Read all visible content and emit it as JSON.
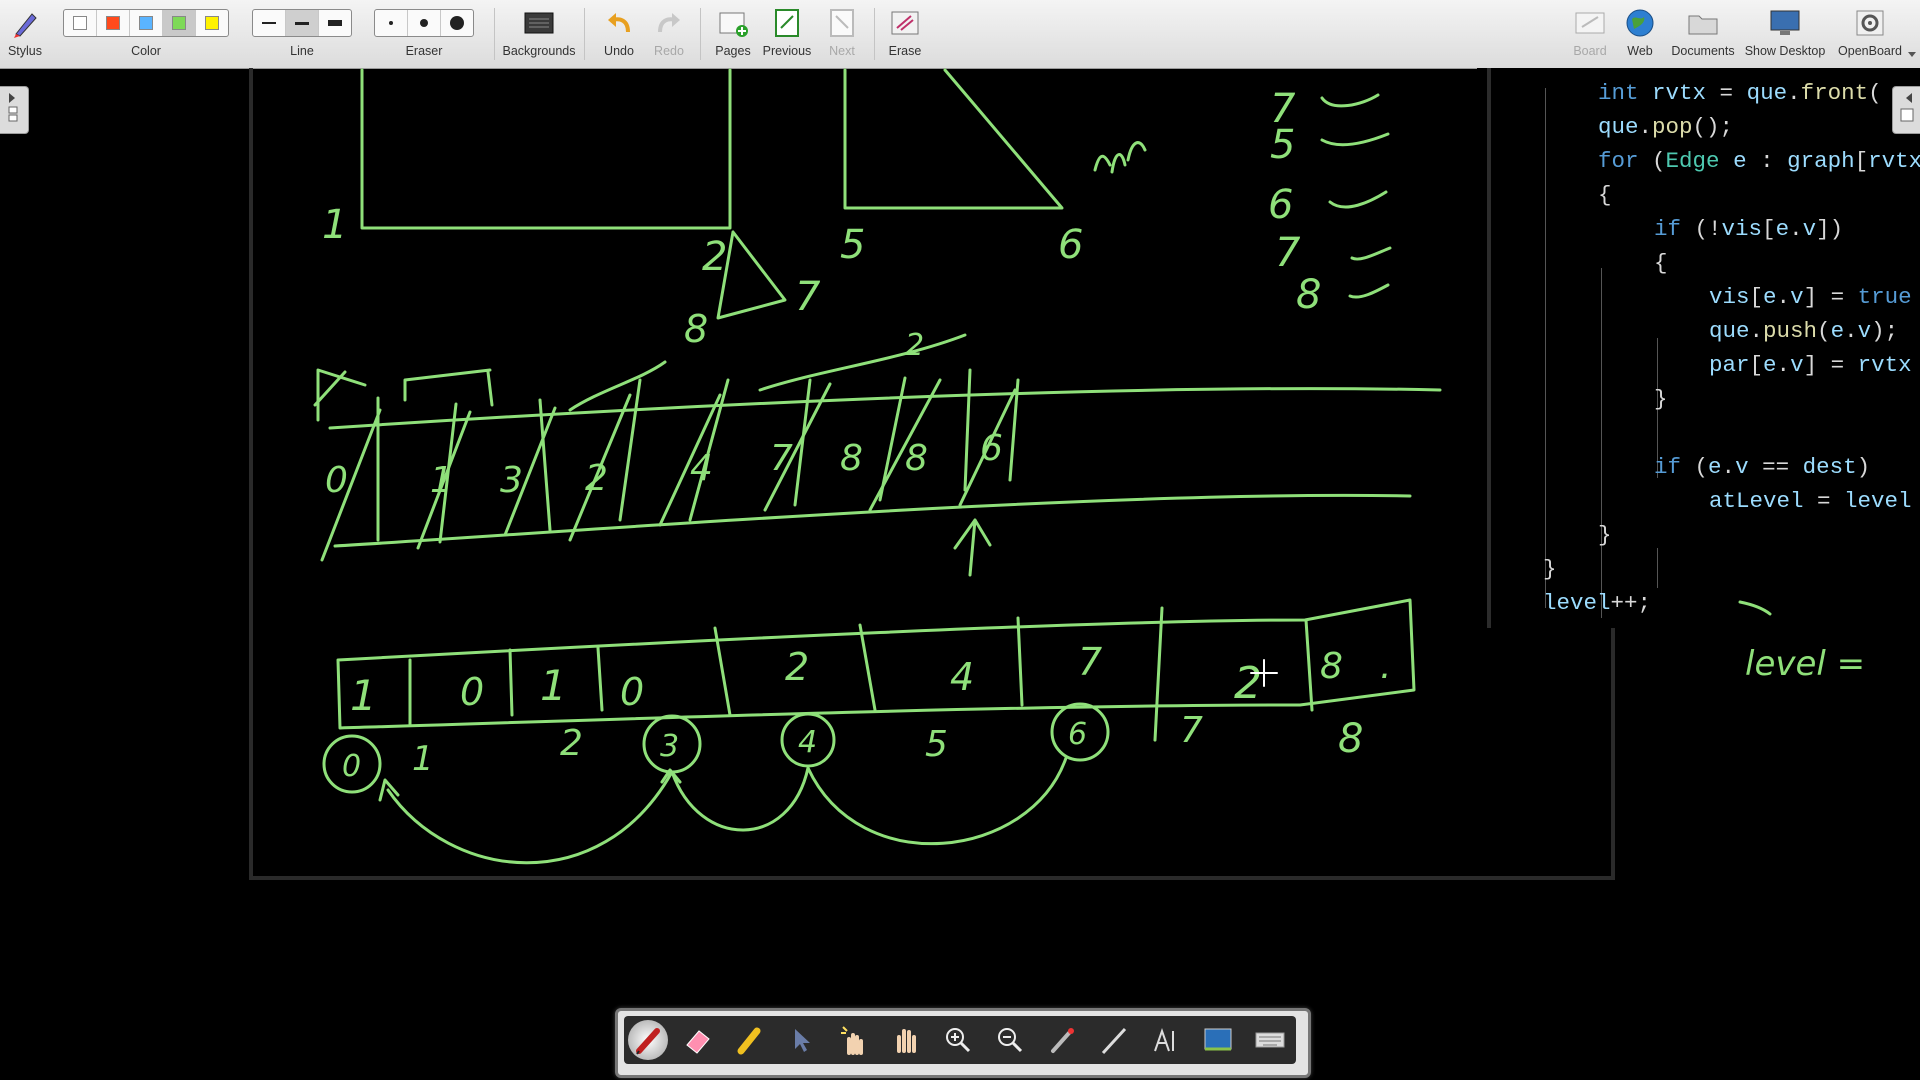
{
  "toolbar": {
    "stylus": "Stylus",
    "color": "Color",
    "line": "Line",
    "eraser": "Eraser",
    "backgrounds": "Backgrounds",
    "undo": "Undo",
    "redo": "Redo",
    "pages": "Pages",
    "previous": "Previous",
    "next": "Next",
    "erase": "Erase",
    "board": "Board",
    "web": "Web",
    "documents": "Documents",
    "show_desktop": "Show Desktop",
    "openboard": "OpenBoard",
    "colors": [
      "#ffffff",
      "#ff4a1c",
      "#5ab4ff",
      "#7ed957",
      "#fff200"
    ]
  },
  "code": {
    "lines": [
      "int rvtx = que.front(",
      "que.pop();",
      "for (Edge e : graph[rvtx",
      "{",
      "if (!vis[e.v])",
      "{",
      "vis[e.v] = true",
      "que.push(e.v);",
      "par[e.v] = rvtx",
      "}",
      "if (e.v == dest)",
      "atLevel = level",
      "}",
      "}",
      "level++;"
    ]
  },
  "ink": {
    "top_digits": [
      "1",
      "5",
      "6",
      "2",
      "7",
      "8"
    ],
    "checklist": [
      "7",
      "5",
      "6",
      "7",
      "8"
    ],
    "queue_digits": [
      "0",
      "1",
      "3",
      "2",
      "4",
      "7",
      "8",
      "8",
      "6",
      "2"
    ],
    "array_values": [
      "1",
      "0",
      "1",
      "0",
      "2",
      "4",
      "7",
      "2",
      "8",
      "."
    ],
    "array_indices": [
      "0",
      "1",
      "2",
      "3",
      "4",
      "5",
      "6",
      "7",
      "8"
    ],
    "side_note": "level ="
  },
  "palette": {
    "tools": [
      "pen-tool",
      "eraser-tool",
      "marker-tool",
      "selector-tool",
      "interact-tool",
      "hand-tool",
      "zoom-in-tool",
      "zoom-out-tool",
      "laser-tool",
      "line-tool",
      "text-tool",
      "capture-tool",
      "keyboard-tool"
    ]
  }
}
